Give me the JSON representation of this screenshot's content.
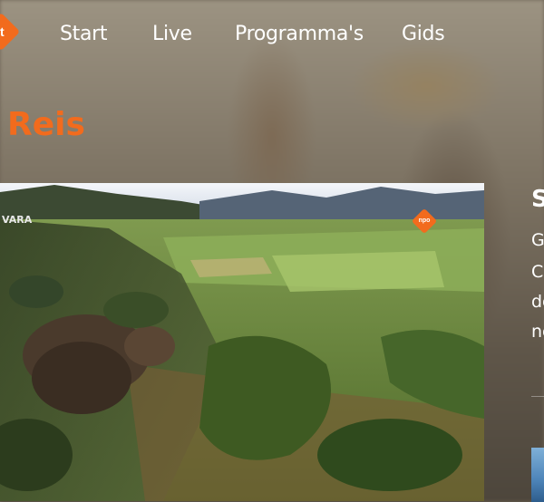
{
  "nav": {
    "logo_letter": "t",
    "items": [
      {
        "label": "Start"
      },
      {
        "label": "Live"
      },
      {
        "label": "Programma's"
      },
      {
        "label": "Gids"
      }
    ]
  },
  "page": {
    "title": "Reis"
  },
  "video": {
    "watermark": "VARA",
    "badge": "npo"
  },
  "side": {
    "heading": "S",
    "lines": [
      "G",
      "C",
      "de",
      "ne"
    ]
  },
  "colors": {
    "accent": "#f26b1d",
    "text": "#ffffff"
  }
}
